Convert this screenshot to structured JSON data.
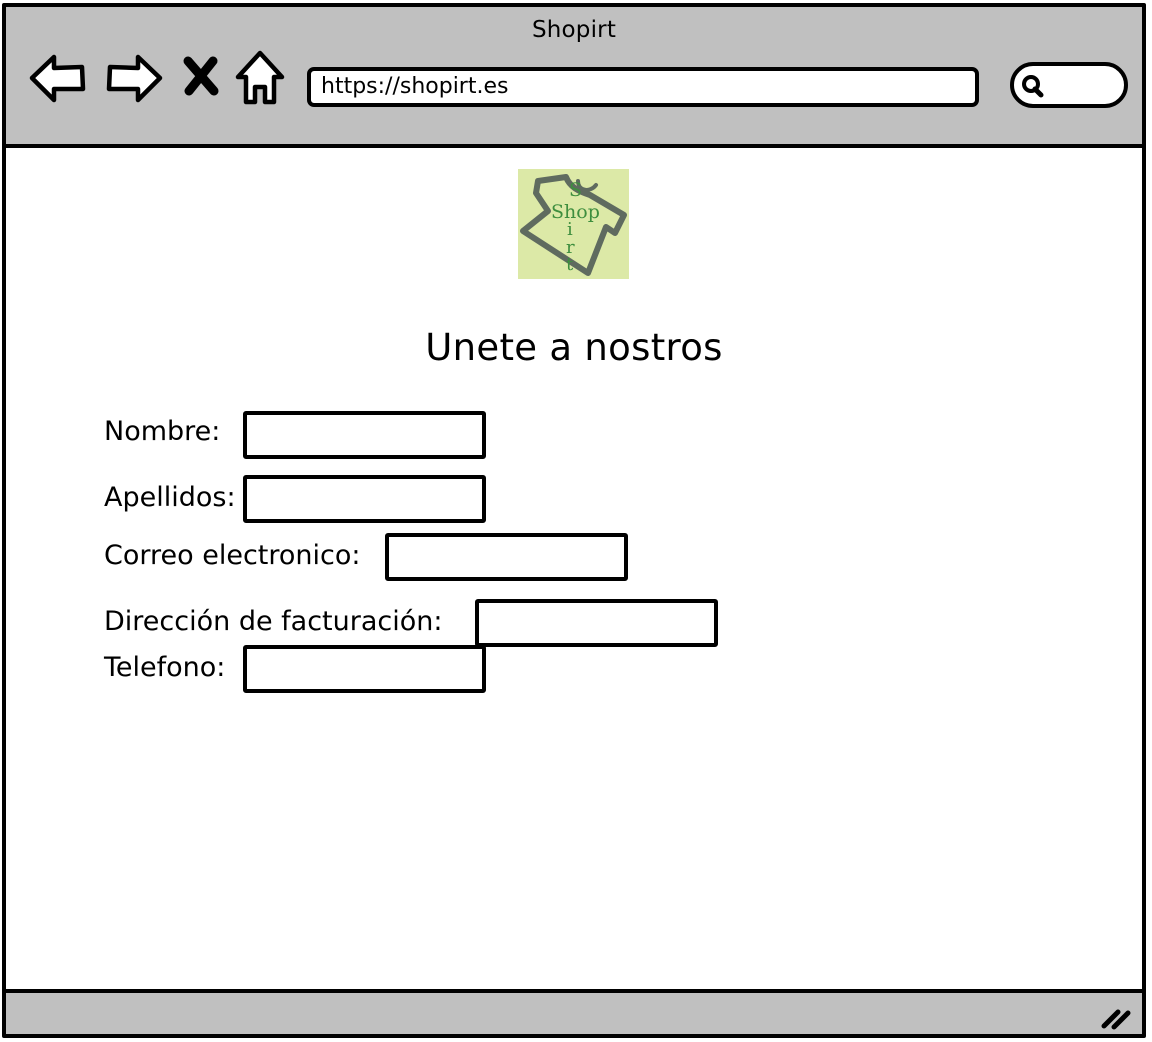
{
  "window": {
    "title": "Shopirt"
  },
  "toolbar": {
    "back_icon": "back-arrow-icon",
    "forward_icon": "forward-arrow-icon",
    "stop_icon": "close-x-icon",
    "home_icon": "home-icon",
    "search_icon": "search-icon"
  },
  "address_bar": {
    "url": "https://shopirt.es"
  },
  "logo": {
    "text_shop": "Shop",
    "text_s": "S",
    "text_i": "i",
    "text_r": "r",
    "text_t": "t",
    "background_color": "#dce9a7",
    "text_color": "#3e8e3e",
    "shirt_color": "#5f6b5f"
  },
  "page": {
    "heading": "Unete a nostros"
  },
  "form": {
    "fields": [
      {
        "label": "Nombre:",
        "value": "",
        "placeholder": ""
      },
      {
        "label": "Apellidos:",
        "value": "",
        "placeholder": ""
      },
      {
        "label": "Correo electronico:",
        "value": "",
        "placeholder": ""
      },
      {
        "label": "Dirección de facturación:",
        "value": "",
        "placeholder": ""
      },
      {
        "label": "Telefono:",
        "value": "",
        "placeholder": ""
      }
    ]
  },
  "statusbar": {
    "resize_icon": "resize-grip-icon"
  },
  "colors": {
    "chrome": "#c0c0c0",
    "border": "#000000",
    "page_background": "#ffffff"
  }
}
